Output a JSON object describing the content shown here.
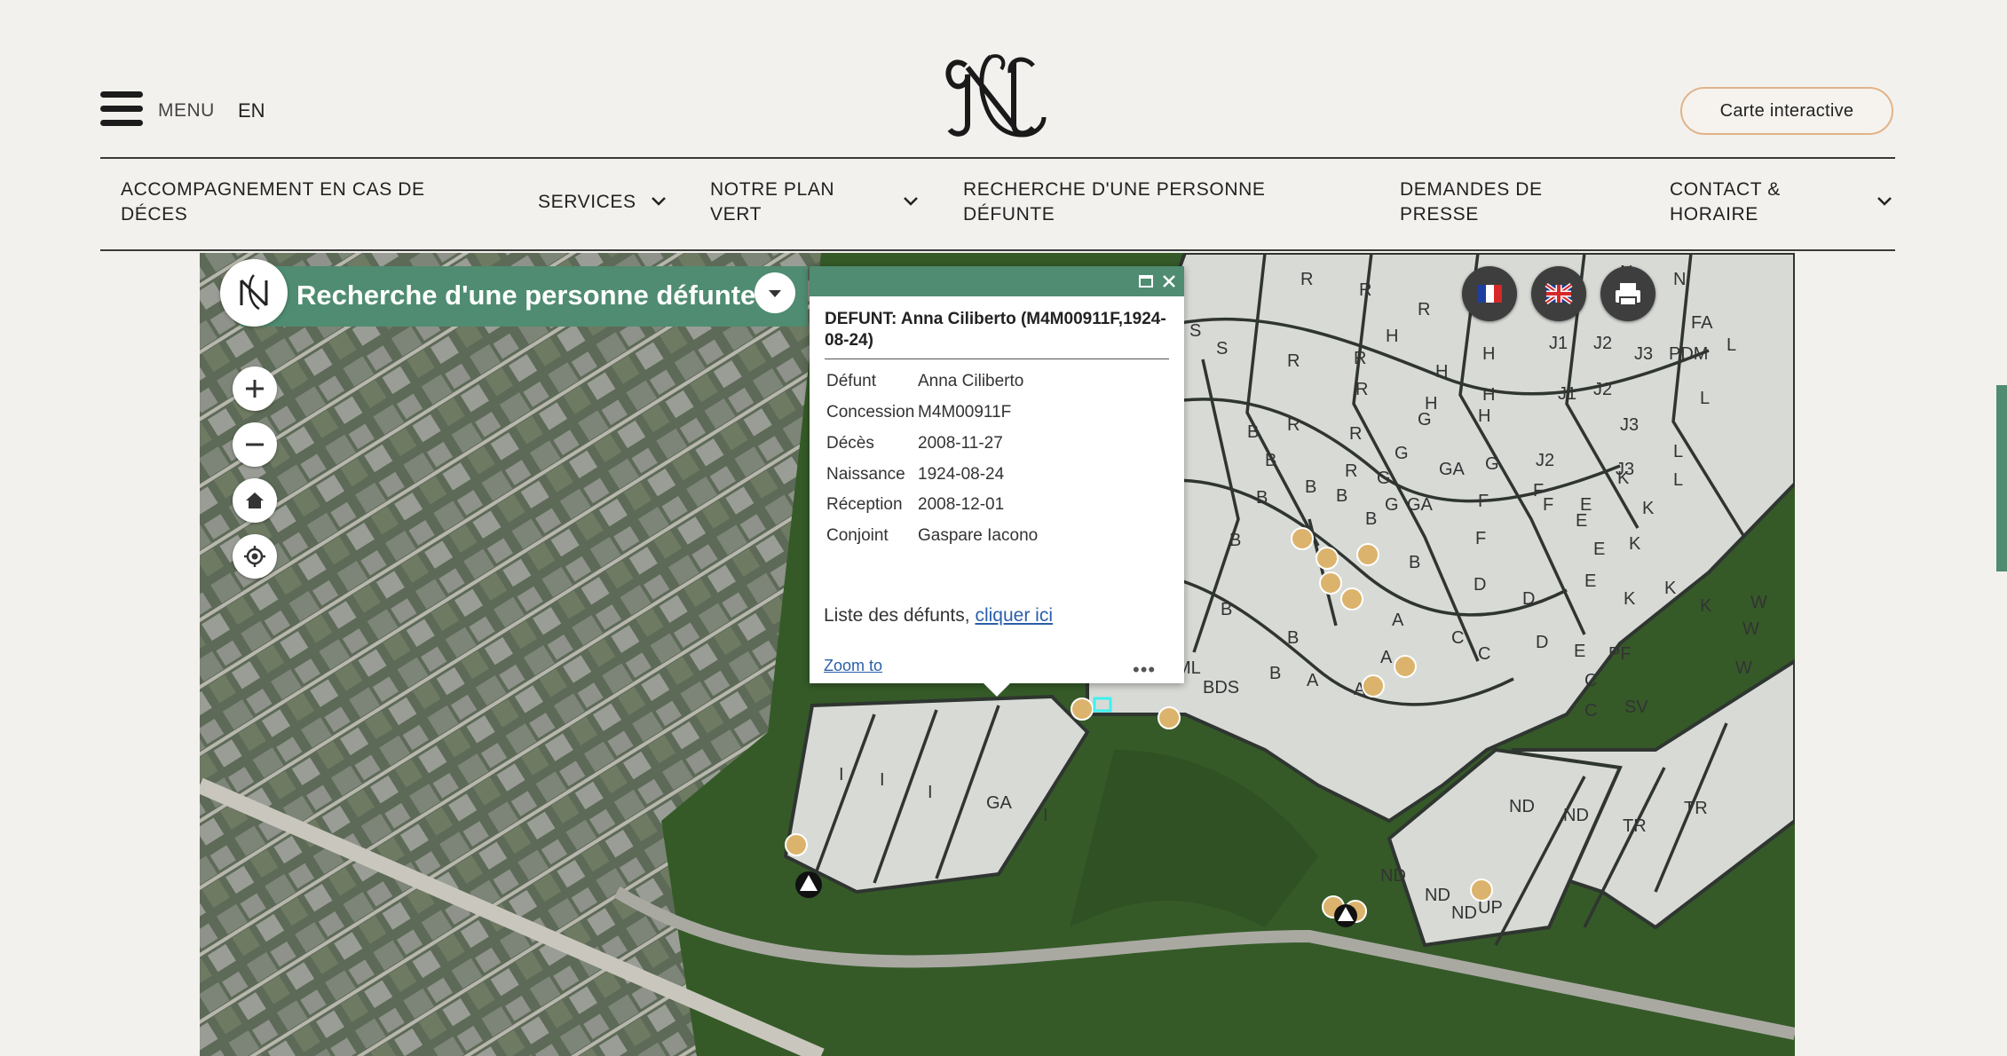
{
  "header": {
    "menu_label": "MENU",
    "lang_label": "EN",
    "cta_label": "Carte interactive"
  },
  "nav": {
    "items": [
      {
        "label_line1": "ACCOMPAGNEMENT EN CAS DE",
        "label_line2": "DÉCES",
        "has_dropdown": false
      },
      {
        "label_line1": "SERVICES",
        "label_line2": "",
        "has_dropdown": true
      },
      {
        "label_line1": "NOTRE PLAN",
        "label_line2": "VERT",
        "has_dropdown": true
      },
      {
        "label_line1": "RECHERCHE D'UNE PERSONNE",
        "label_line2": "DÉFUNTE",
        "has_dropdown": false
      },
      {
        "label_line1": "DEMANDES DE",
        "label_line2": "PRESSE",
        "has_dropdown": false
      },
      {
        "label_line1": "CONTACT &",
        "label_line2": "HORAIRE",
        "has_dropdown": true
      }
    ]
  },
  "map_widget": {
    "title": "Recherche d'une personne défunte",
    "controls": [
      "zoom-in",
      "zoom-out",
      "home",
      "locate"
    ],
    "toolbar": [
      "flag-fr",
      "flag-uk",
      "print"
    ],
    "section_labels": [
      "S",
      "R",
      "R",
      "R",
      "N",
      "N",
      "S",
      "R",
      "R",
      "H",
      "H",
      "H",
      "J1",
      "J2",
      "J3",
      "FA",
      "L",
      "PDM",
      "R",
      "R",
      "H",
      "J1",
      "J2",
      "J3",
      "B",
      "R",
      "R",
      "G",
      "H",
      "H",
      "J3",
      "L",
      "B",
      "R",
      "G",
      "GA",
      "G",
      "J2",
      "K",
      "L",
      "B",
      "B",
      "G",
      "G",
      "F",
      "J3",
      "K",
      "B",
      "B",
      "GA",
      "F",
      "F",
      "E",
      "K",
      "B",
      "B",
      "B",
      "F",
      "E",
      "K",
      "E",
      "B",
      "D",
      "D",
      "E",
      "K",
      "K",
      "W",
      "B",
      "A",
      "C",
      "D",
      "W",
      "B",
      "C",
      "E",
      "PF",
      "W",
      "A",
      "A",
      "C",
      "SV",
      "B",
      "BDS",
      "ML",
      "I",
      "I",
      "I",
      "GA",
      "I",
      "ND",
      "ND",
      "TR",
      "TR",
      "ND",
      "ND",
      "UP",
      "ND"
    ],
    "popup": {
      "title": "DEFUNT: Anna Ciliberto (M4M00911F,1924-08-24)",
      "attributes": [
        {
          "key": "Défunt",
          "value": "Anna Ciliberto"
        },
        {
          "key": "Concession",
          "value": "M4M00911F"
        },
        {
          "key": "Décès",
          "value": "2008-11-27"
        },
        {
          "key": "Naissance",
          "value": "1924-08-24"
        },
        {
          "key": "Réception",
          "value": "2008-12-01"
        },
        {
          "key": "Conjoint",
          "value": "Gaspare Iacono"
        }
      ],
      "list_prefix": "Liste des défunts, ",
      "list_link": "cliquer ici",
      "zoom_to": "Zoom to",
      "more": "•••"
    }
  },
  "colors": {
    "accent_green": "#4f8c71",
    "cta_border": "#e2b48a",
    "background": "#f3f1ed",
    "poi_marker": "#dcb36c"
  }
}
